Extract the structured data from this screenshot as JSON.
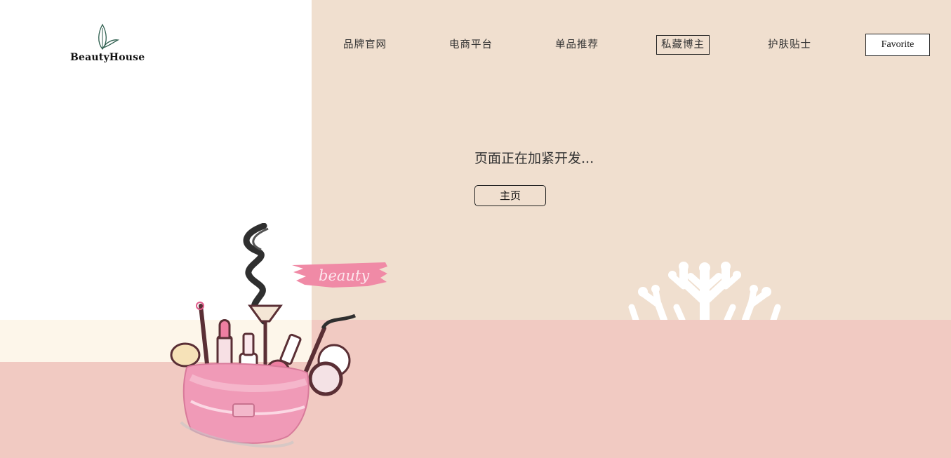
{
  "brand": {
    "name": "BeautyHouse"
  },
  "nav": {
    "items": [
      {
        "label": "品牌官网"
      },
      {
        "label": "电商平台"
      },
      {
        "label": "单品推荐"
      },
      {
        "label": "私藏博主"
      },
      {
        "label": "护肤贴士"
      }
    ],
    "favorite_label": "Favorite"
  },
  "main": {
    "message": "页面正在加紧开发...",
    "home_button_label": "主页"
  },
  "illustration": {
    "brush_text": "beauty"
  },
  "colors": {
    "beige": "#f0dfcf",
    "pink": "#f1cac2",
    "cream": "#fdf6ea",
    "accent_pink": "#f08aa6"
  }
}
